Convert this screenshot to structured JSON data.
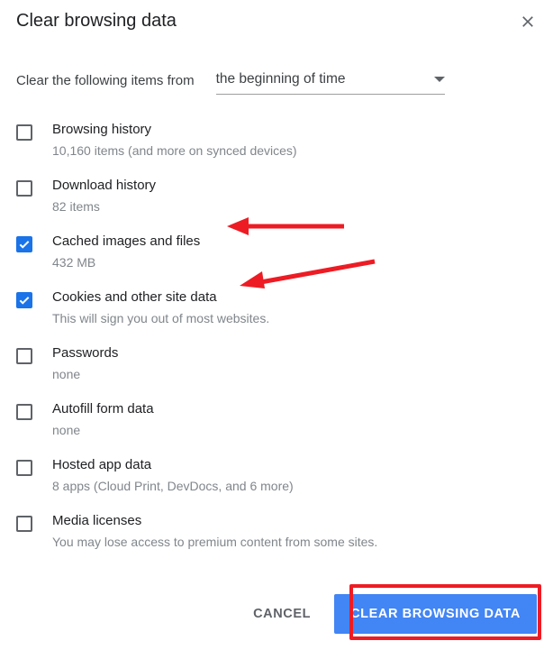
{
  "dialog": {
    "title": "Clear browsing data",
    "from_label": "Clear the following items from",
    "time_range": "the beginning of time"
  },
  "options": [
    {
      "label": "Browsing history",
      "sub": "10,160 items (and more on synced devices)",
      "checked": false
    },
    {
      "label": "Download history",
      "sub": "82 items",
      "checked": false
    },
    {
      "label": "Cached images and files",
      "sub": "432 MB",
      "checked": true
    },
    {
      "label": "Cookies and other site data",
      "sub": "This will sign you out of most websites.",
      "checked": true
    },
    {
      "label": "Passwords",
      "sub": "none",
      "checked": false
    },
    {
      "label": "Autofill form data",
      "sub": "none",
      "checked": false
    },
    {
      "label": "Hosted app data",
      "sub": "8 apps (Cloud Print, DevDocs, and 6 more)",
      "checked": false
    },
    {
      "label": "Media licenses",
      "sub": "You may lose access to premium content from some sites.",
      "checked": false
    }
  ],
  "actions": {
    "cancel": "CANCEL",
    "confirm": "CLEAR BROWSING DATA"
  }
}
